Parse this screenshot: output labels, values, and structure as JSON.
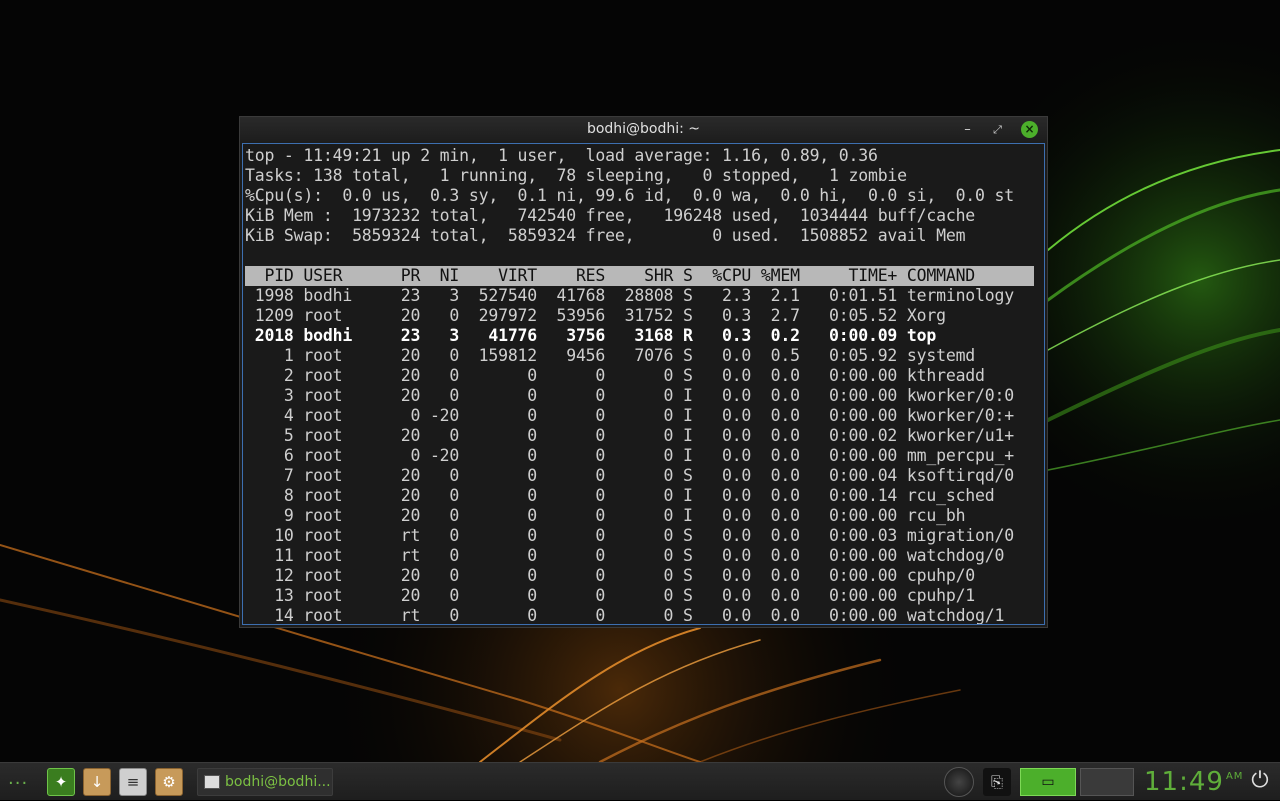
{
  "window": {
    "title": "bodhi@bodhi: ~",
    "minimize_glyph": "–",
    "maximize_glyph": "⤢",
    "close_glyph": "×"
  },
  "top": {
    "summary": [
      "top - 11:49:21 up 2 min,  1 user,  load average: 1.16, 0.89, 0.36",
      "Tasks: 138 total,   1 running,  78 sleeping,   0 stopped,   1 zombie",
      "%Cpu(s):  0.0 us,  0.3 sy,  0.1 ni, 99.6 id,  0.0 wa,  0.0 hi,  0.0 si,  0.0 st",
      "KiB Mem :  1973232 total,   742540 free,   196248 used,  1034444 buff/cache",
      "KiB Swap:  5859324 total,  5859324 free,        0 used.  1508852 avail Mem"
    ],
    "header": "  PID USER      PR  NI    VIRT    RES    SHR S  %CPU %MEM     TIME+ COMMAND     ",
    "rows": [
      " 1998 bodhi     23   3  527540  41768  28808 S   2.3  2.1   0:01.51 terminology",
      " 1209 root      20   0  297972  53956  31752 S   0.3  2.7   0:05.52 Xorg",
      " 2018 bodhi     23   3   41776   3756   3168 R   0.3  0.2   0:00.09 top",
      "    1 root      20   0  159812   9456   7076 S   0.0  0.5   0:05.92 systemd",
      "    2 root      20   0       0      0      0 S   0.0  0.0   0:00.00 kthreadd",
      "    3 root      20   0       0      0      0 I   0.0  0.0   0:00.00 kworker/0:0",
      "    4 root       0 -20       0      0      0 I   0.0  0.0   0:00.00 kworker/0:+",
      "    5 root      20   0       0      0      0 I   0.0  0.0   0:00.02 kworker/u1+",
      "    6 root       0 -20       0      0      0 I   0.0  0.0   0:00.00 mm_percpu_+",
      "    7 root      20   0       0      0      0 S   0.0  0.0   0:00.04 ksoftirqd/0",
      "    8 root      20   0       0      0      0 I   0.0  0.0   0:00.14 rcu_sched",
      "    9 root      20   0       0      0      0 I   0.0  0.0   0:00.00 rcu_bh",
      "   10 root      rt   0       0      0      0 S   0.0  0.0   0:00.03 migration/0",
      "   11 root      rt   0       0      0      0 S   0.0  0.0   0:00.00 watchdog/0",
      "   12 root      20   0       0      0      0 S   0.0  0.0   0:00.00 cpuhp/0",
      "   13 root      20   0       0      0      0 S   0.0  0.0   0:00.00 cpuhp/1",
      "   14 root      rt   0       0      0      0 S   0.0  0.0   0:00.00 watchdog/1"
    ],
    "highlighted_row_index": 2
  },
  "taskbar": {
    "menu_glyph": "···",
    "launchers": [
      {
        "icon": "compass-icon",
        "glyph": "✦"
      },
      {
        "icon": "package-install-icon",
        "glyph": "↓"
      },
      {
        "icon": "file-manager-icon",
        "glyph": "≡"
      },
      {
        "icon": "package-manager-icon",
        "glyph": "⚙"
      }
    ],
    "task_label": "bodhi@bodhi...",
    "clipboard_glyph": "⎘",
    "pager_glyph": "▭",
    "clock": "11:49",
    "clock_ampm": "AM",
    "power_glyph": "⏻"
  },
  "colors": {
    "accent": "#4caf2b",
    "clock": "#5fae3a"
  }
}
